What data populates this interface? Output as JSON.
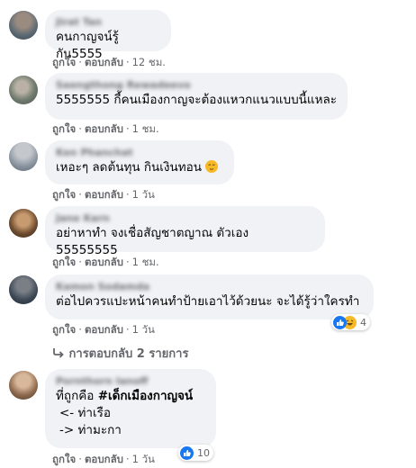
{
  "actions": {
    "like": "ถูกใจ",
    "reply": "ตอบกลับ"
  },
  "comments": [
    {
      "author": "Jirat Tan",
      "text": "คนกาญจน์รู้กัน5555",
      "time": "12 ชม."
    },
    {
      "author": "Saengthong Rewadeevo",
      "text": "5555555 กี้คนเมืองกาญจะต้องแหวกแนวแบบนี้แหละ",
      "time": "1 ชม."
    },
    {
      "author": "Ken Phanchat",
      "text": "เหอะๆ ลดต้นทุน กินเงินทอน",
      "emoji": "relieved-face-emoji",
      "time": "1 วัน"
    },
    {
      "author": "Jane Karn",
      "text": "อย่าหาทำ จงเชื่อสัญชาตญาณ ตัวเอง 55555555",
      "time": "1 ชม."
    },
    {
      "author": "Kamon Sodamda",
      "text": "ต่อไปควรแปะหน้าคนทำป้ายเอาไว้ด้วยนะ จะได้รู้ว่าใครทำ",
      "reactions": "4",
      "time": "1 วัน"
    },
    {
      "author": "Pornthorn Ianoff",
      "lines": [
        "ที่ถูกคือ ",
        "#เด็กเมืองกาญจน์",
        "<- ท่าเรือ",
        "-> ท่ามะกา"
      ],
      "reactions": "10",
      "time": "1 วัน"
    }
  ],
  "replies_link": "การตอบกลับ 2 รายการ",
  "colors": {
    "bubble": "#f0f2f5",
    "meta": "#65676b",
    "like_blue": "#1877f2",
    "haha_yellow": "#f7b928"
  }
}
